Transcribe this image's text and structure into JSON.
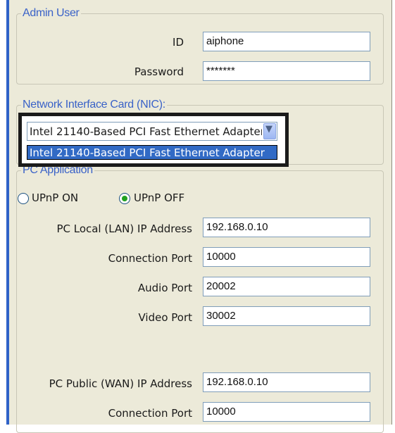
{
  "admin_user": {
    "legend": "Admin User",
    "id_label": "ID",
    "id_value": "aiphone",
    "password_label": "Password",
    "password_value": "*******"
  },
  "nic": {
    "legend": "Network Interface Card (NIC):",
    "selected": "Intel 21140-Based PCI Fast Ethernet Adapter",
    "list_option": "Intel 21140-Based PCI Fast Ethernet Adapter"
  },
  "pc_app": {
    "legend": "PC Application",
    "upnp_on": "UPnP ON",
    "upnp_off": "UPnP OFF",
    "upnp_selected": "off",
    "lan_ip_label": "PC Local (LAN) IP Address",
    "lan_ip_value": "192.168.0.10",
    "lan_port_label": "Connection Port",
    "lan_port_value": "10000",
    "audio_label": "Audio Port",
    "audio_value": "20002",
    "video_label": "Video Port",
    "video_value": "30002",
    "wan_ip_label": "PC Public (WAN) IP Address",
    "wan_ip_value": "192.168.0.10",
    "wan_port_label": "Connection Port",
    "wan_port_value": "10000"
  },
  "colors": {
    "legend": "#3a62c8",
    "selection": "#316ac5",
    "panel": "#ecead9",
    "radio_dot": "#21a121"
  }
}
